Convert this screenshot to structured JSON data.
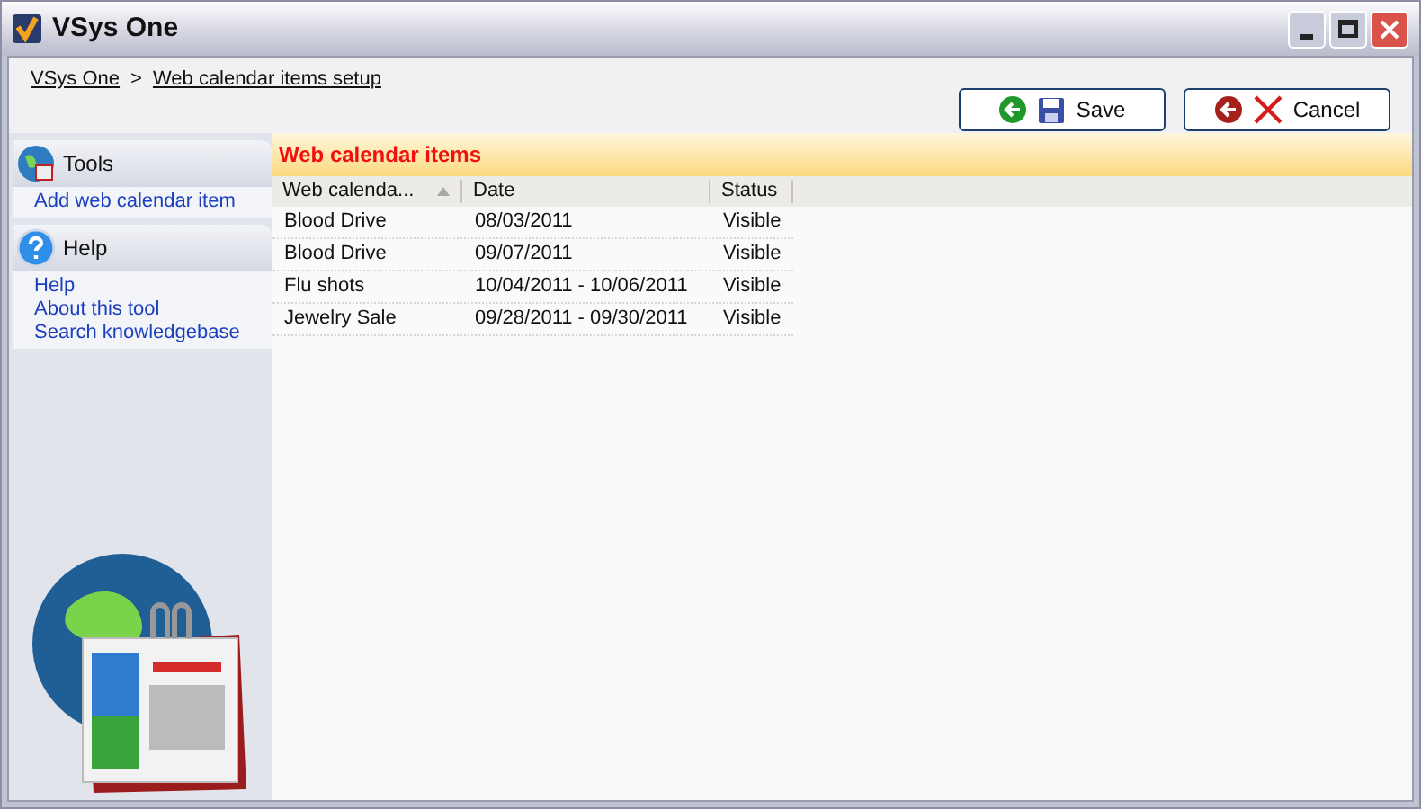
{
  "window": {
    "title": "VSys One"
  },
  "breadcrumb": [
    {
      "label": "VSys One"
    },
    {
      "label": "Web calendar items setup"
    }
  ],
  "breadcrumb_separator": ">",
  "buttons": [
    {
      "kind": "save",
      "label": "Save"
    },
    {
      "kind": "cancel",
      "label": "Cancel"
    }
  ],
  "sidebar": {
    "sections": [
      {
        "kind": "tools",
        "title": "Tools",
        "items": [
          "Add web calendar item"
        ]
      },
      {
        "kind": "help",
        "title": "Help",
        "items": [
          "Help",
          "About this tool",
          "Search knowledgebase"
        ]
      }
    ]
  },
  "panel": {
    "title": "Web calendar items"
  },
  "table": {
    "columns": [
      {
        "label": "Web calenda...",
        "sorted": true
      },
      {
        "label": "Date",
        "sorted": false
      },
      {
        "label": "Status",
        "sorted": false
      }
    ],
    "rows": [
      [
        "Blood Drive",
        "08/03/2011",
        "Visible"
      ],
      [
        "Blood Drive",
        "09/07/2011",
        "Visible"
      ],
      [
        "Flu shots",
        "10/04/2011 - 10/06/2011",
        "Visible"
      ],
      [
        "Jewelry Sale",
        "09/28/2011 - 09/30/2011",
        "Visible"
      ]
    ]
  }
}
